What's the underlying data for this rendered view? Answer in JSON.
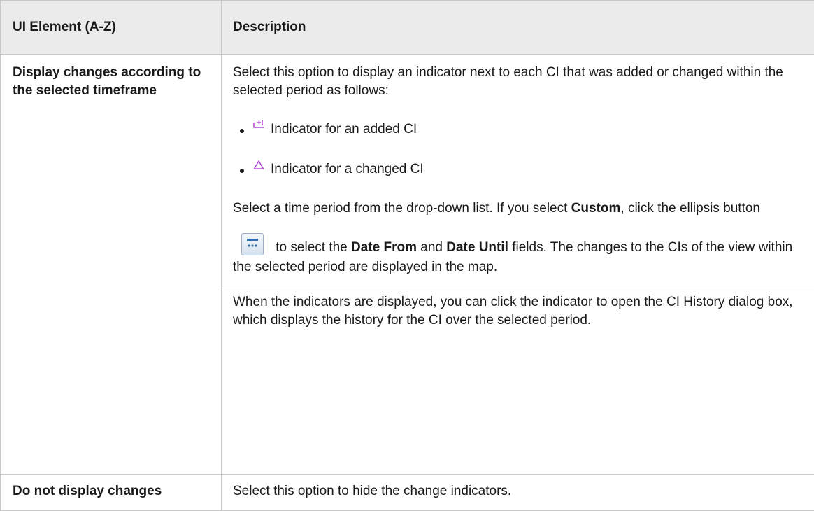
{
  "table": {
    "headers": [
      "UI Element (A-Z)",
      "Description"
    ],
    "rows": [
      {
        "element": "Display changes according to the selected timeframe",
        "intro": "Select this option to display an indicator next to each CI that was added or changed within the selected period as follows:",
        "bullets": [
          {
            "icon": "added-ci-indicator-icon",
            "text": "Indicator for an added CI"
          },
          {
            "icon": "changed-ci-indicator-icon",
            "text": "Indicator for a changed CI"
          }
        ],
        "para2": {
          "before_custom": "Select a time period from the drop-down list. If you select ",
          "custom": "Custom",
          "after_custom": ", click the ellipsis button",
          "to_select": " to select the ",
          "date_from": "Date From",
          "and": " and ",
          "date_until": "Date Until",
          "rest": " fields. The changes to the CIs of the view within the selected period are displayed in the map."
        },
        "para3": "When the indicators are displayed, you can click the indicator to open the CI History dialog box, which displays the history for the CI over the selected period."
      },
      {
        "element": "Do not display changes",
        "description": "Select this option to hide the change indicators."
      }
    ]
  },
  "colors": {
    "header_bg": "#ebebeb",
    "border": "#c8c8c8",
    "indicator": "#b04fd0"
  }
}
